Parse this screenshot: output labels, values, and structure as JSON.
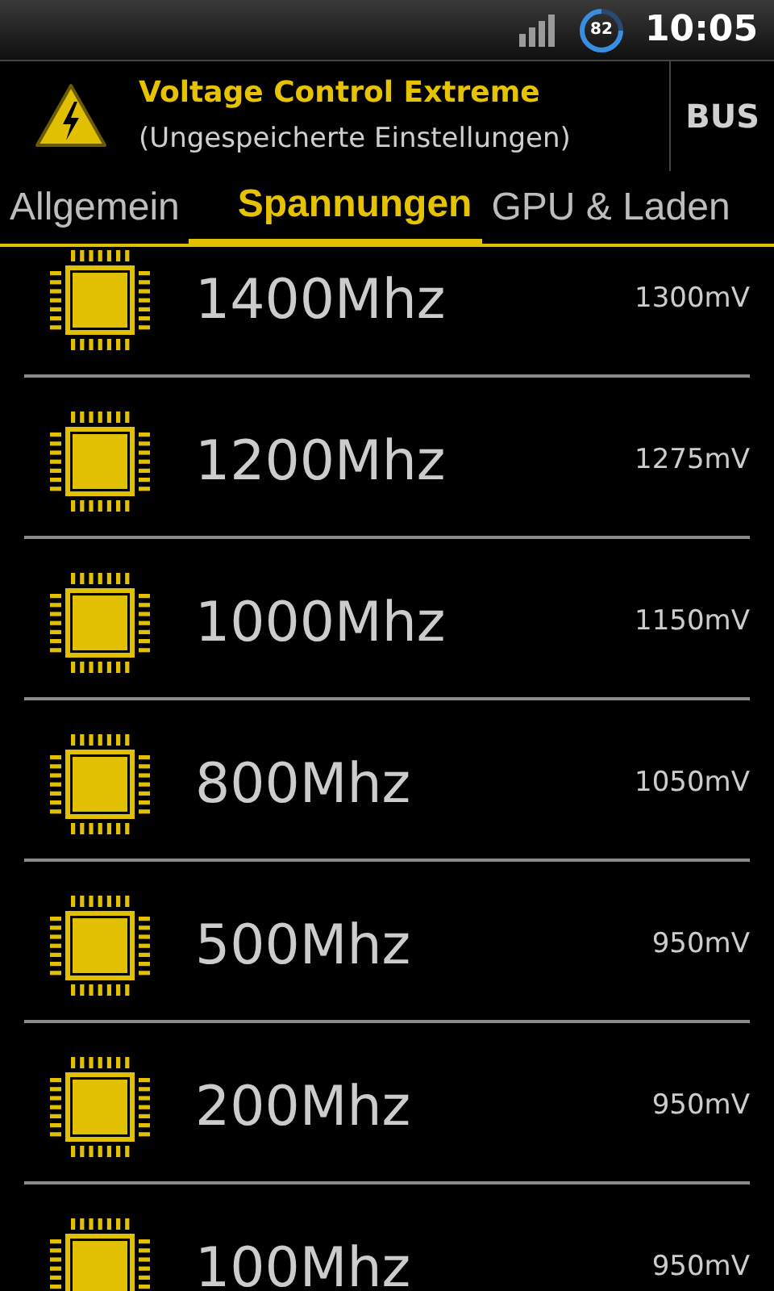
{
  "status_bar": {
    "battery": "82",
    "time": "10:05"
  },
  "header": {
    "title": "Voltage Control Extreme",
    "subtitle": "(Ungespeicherte Einstellungen)",
    "action": "BUS"
  },
  "tabs": [
    {
      "label": "Allgemein",
      "selected": false
    },
    {
      "label": "Spannungen",
      "selected": true
    },
    {
      "label": "GPU & Laden",
      "selected": false
    }
  ],
  "frequencies": [
    {
      "frequency": "1400Mhz",
      "voltage": "1300mV"
    },
    {
      "frequency": "1200Mhz",
      "voltage": "1275mV"
    },
    {
      "frequency": "1000Mhz",
      "voltage": "1150mV"
    },
    {
      "frequency": "800Mhz",
      "voltage": "1050mV"
    },
    {
      "frequency": "500Mhz",
      "voltage": "950mV"
    },
    {
      "frequency": "200Mhz",
      "voltage": "950mV"
    },
    {
      "frequency": "100Mhz",
      "voltage": "950mV"
    }
  ]
}
